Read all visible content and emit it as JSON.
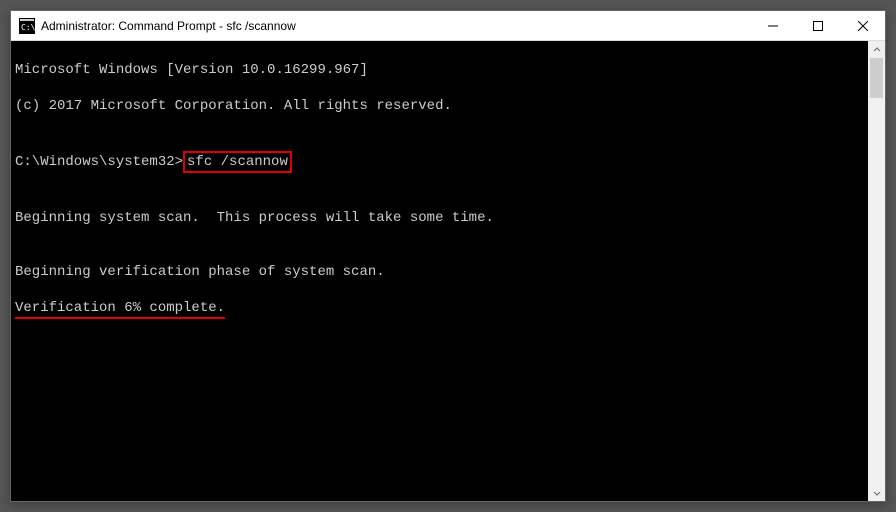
{
  "window": {
    "title": "Administrator: Command Prompt - sfc  /scannow"
  },
  "terminal": {
    "line1": "Microsoft Windows [Version 10.0.16299.967]",
    "line2": "(c) 2017 Microsoft Corporation. All rights reserved.",
    "blank1": "",
    "prompt_path": "C:\\Windows\\system32>",
    "command": "sfc /scannow",
    "blank2": "",
    "line3": "Beginning system scan.  This process will take some time.",
    "blank3": "",
    "line4": "Beginning verification phase of system scan.",
    "line5": "Verification 6% complete."
  }
}
